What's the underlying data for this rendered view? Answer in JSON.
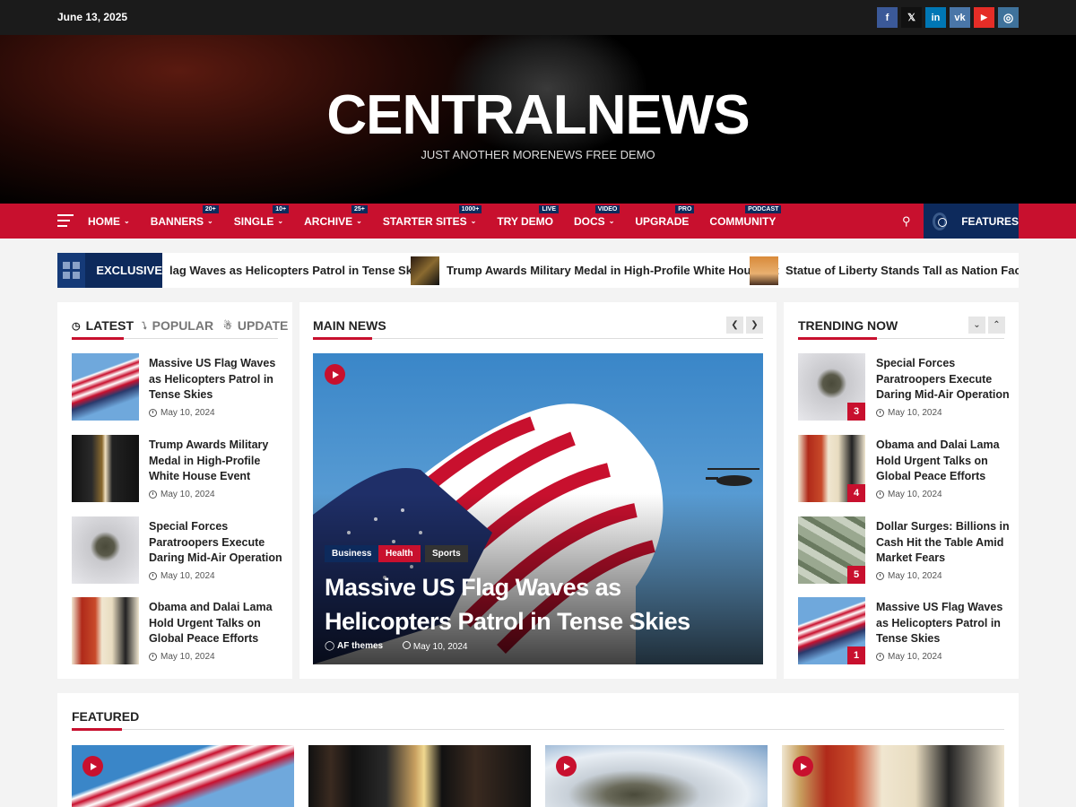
{
  "topbar": {
    "date": "June 13, 2025",
    "social": [
      {
        "name": "facebook",
        "glyph": "f",
        "color": "#3b5998"
      },
      {
        "name": "x",
        "glyph": "𝕏",
        "color": "#111111"
      },
      {
        "name": "linkedin",
        "glyph": "in",
        "color": "#0077b5"
      },
      {
        "name": "vk",
        "glyph": "vk",
        "color": "#4a76a8"
      },
      {
        "name": "youtube",
        "glyph": "▶",
        "color": "#e52d27"
      },
      {
        "name": "instagram",
        "glyph": "◎",
        "color": "#3f729b"
      }
    ]
  },
  "header": {
    "title": "CENTRALNEWS",
    "tagline": "JUST ANOTHER MORENEWS FREE DEMO"
  },
  "nav": {
    "items": [
      {
        "label": "HOME",
        "chev": true,
        "badge": ""
      },
      {
        "label": "BANNERS",
        "chev": true,
        "badge": "20+"
      },
      {
        "label": "SINGLE",
        "chev": true,
        "badge": "10+"
      },
      {
        "label": "ARCHIVE",
        "chev": true,
        "badge": "25+"
      },
      {
        "label": "STARTER SITES",
        "chev": true,
        "badge": "1000+"
      },
      {
        "label": "TRY DEMO",
        "chev": false,
        "badge": "LIVE"
      },
      {
        "label": "DOCS",
        "chev": true,
        "badge": "VIDEO"
      },
      {
        "label": "UPGRADE",
        "chev": false,
        "badge": "PRO"
      },
      {
        "label": "COMMUNITY",
        "chev": false,
        "badge": "PODCAST"
      }
    ],
    "features_label": "FEATURES"
  },
  "ticker": {
    "label": "EXCLUSIVE",
    "items": [
      "lag Waves as Helicopters Patrol in Tense Skies",
      "Trump Awards Military Medal in High-Profile White House Et",
      "Statue of Liberty Stands Tall as Nation Faces Unce"
    ]
  },
  "left": {
    "tabs": [
      "LATEST",
      "POPULAR",
      "UPDATE"
    ],
    "items": [
      {
        "title": "Massive US Flag Waves as Helicopters Patrol in Tense Skies",
        "date": "May 10, 2024"
      },
      {
        "title": "Trump Awards Military Medal in High-Profile White House Event",
        "date": "May 10, 2024"
      },
      {
        "title": "Special Forces Paratroopers Execute Daring Mid-Air Operation",
        "date": "May 10, 2024"
      },
      {
        "title": "Obama and Dalai Lama Hold Urgent Talks on Global Peace Efforts",
        "date": "May 10, 2024"
      }
    ]
  },
  "main": {
    "title": "MAIN NEWS",
    "categories": [
      {
        "label": "Business",
        "color": "#0d2a5c"
      },
      {
        "label": "Health",
        "color": "#c8102e"
      },
      {
        "label": "Sports",
        "color": "#333333"
      }
    ],
    "headline": "Massive US Flag Waves as Helicopters Patrol in Tense Skies",
    "author": "AF themes",
    "date": "May 10, 2024"
  },
  "trending": {
    "title": "TRENDING NOW",
    "items": [
      {
        "title": "Special Forces Paratroopers Execute Daring Mid-Air Operation",
        "date": "May 10, 2024",
        "rank": "3"
      },
      {
        "title": "Obama and Dalai Lama Hold Urgent Talks on Global Peace Efforts",
        "date": "May 10, 2024",
        "rank": "4"
      },
      {
        "title": "Dollar Surges: Billions in Cash Hit the Table Amid Market Fears",
        "date": "May 10, 2024",
        "rank": "5"
      },
      {
        "title": "Massive US Flag Waves as Helicopters Patrol in Tense Skies",
        "date": "May 10, 2024",
        "rank": "1"
      }
    ]
  },
  "featured": {
    "title": "FEATURED"
  },
  "colors": {
    "accent": "#c8102e",
    "navy": "#0d2a5c"
  }
}
